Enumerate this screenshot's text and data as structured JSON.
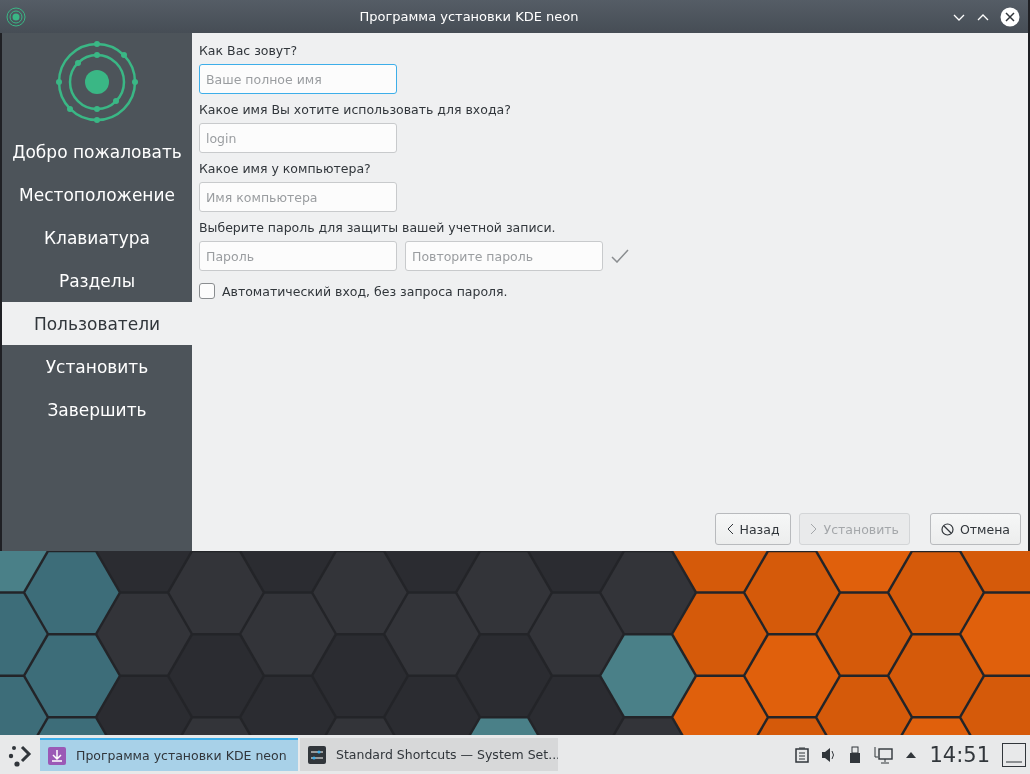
{
  "window": {
    "title": "Программа установки KDE neon"
  },
  "sidebar": {
    "steps": [
      {
        "label": "Добро пожаловать",
        "selected": false
      },
      {
        "label": "Местоположение",
        "selected": false
      },
      {
        "label": "Клавиатура",
        "selected": false
      },
      {
        "label": "Разделы",
        "selected": false
      },
      {
        "label": "Пользователи",
        "selected": true
      },
      {
        "label": "Установить",
        "selected": false
      },
      {
        "label": "Завершить",
        "selected": false
      }
    ]
  },
  "form": {
    "sections": [
      {
        "label": "Как Вас зовут?",
        "fields": [
          {
            "placeholder": "Ваше полное имя",
            "focused": true
          }
        ]
      },
      {
        "label": "Какое имя Вы хотите использовать для входа?",
        "fields": [
          {
            "placeholder": "login",
            "focused": false
          }
        ]
      },
      {
        "label": "Какое имя у компьютера?",
        "fields": [
          {
            "placeholder": "Имя компьютера",
            "focused": false
          }
        ]
      },
      {
        "label": "Выберите пароль для защиты вашей учетной записи.",
        "fields": [
          {
            "placeholder": "Пароль",
            "focused": false
          },
          {
            "placeholder": "Повторите пароль",
            "focused": false
          }
        ]
      }
    ],
    "auto_login": {
      "label": "Автоматический вход, без запроса пароля.",
      "checked": false
    }
  },
  "buttons": [
    {
      "kind": "back",
      "label": "Назад",
      "disabled": false
    },
    {
      "kind": "next",
      "label": "Установить",
      "disabled": true
    },
    {
      "kind": "cancel",
      "label": "Отмена",
      "disabled": false
    }
  ],
  "taskbar": {
    "tasks": [
      {
        "kind": "installer",
        "label": "Программа установки KDE neon",
        "selected": true
      },
      {
        "kind": "settings",
        "label": "Standard Shortcuts  — System Set...",
        "selected": false
      }
    ],
    "clock": "14:51"
  }
}
